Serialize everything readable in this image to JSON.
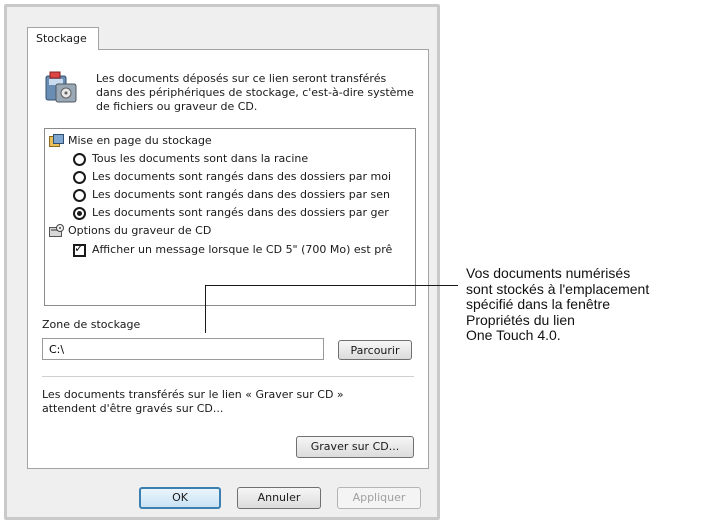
{
  "tab": {
    "label": "Stockage"
  },
  "intro": {
    "icon": "storage-devices-icon",
    "text": "Les documents déposés sur ce lien seront transférés dans des périphériques de stockage, c'est-à-dire système de fichiers ou graveur de CD."
  },
  "tree": {
    "storage_group": {
      "label": "Mise en page du stockage",
      "icon": "folder-layout-icon",
      "options": [
        {
          "label": "Tous les documents sont dans la racine",
          "checked": false
        },
        {
          "label": "Les documents sont rangés dans des dossiers par moi",
          "checked": false
        },
        {
          "label": "Les documents sont rangés dans des dossiers par sen",
          "checked": false
        },
        {
          "label": "Les documents sont rangés dans des dossiers par ger",
          "checked": true
        }
      ]
    },
    "cd_group": {
      "label": "Options du graveur de CD",
      "icon": "cd-burner-icon",
      "checkbox": {
        "label": "Afficher un message lorsque le CD 5\" (700 Mo) est prê",
        "checked": true
      }
    }
  },
  "zone": {
    "label": "Zone de stockage",
    "path_value": "C:\\",
    "browse_label": "Parcourir"
  },
  "cd_note": "Les documents transférés sur le lien « Graver sur CD » attendent d'être gravés sur CD...",
  "burn_button_label": "Graver sur CD...",
  "footer": {
    "ok_label": "OK",
    "cancel_label": "Annuler",
    "apply_label": "Appliquer"
  },
  "callout": {
    "lines": [
      "Vos documents numérisés",
      "sont stockés à l'emplacement",
      "spécifié dans la fenêtre",
      "Propriétés du lien",
      "One Touch 4.0."
    ]
  }
}
